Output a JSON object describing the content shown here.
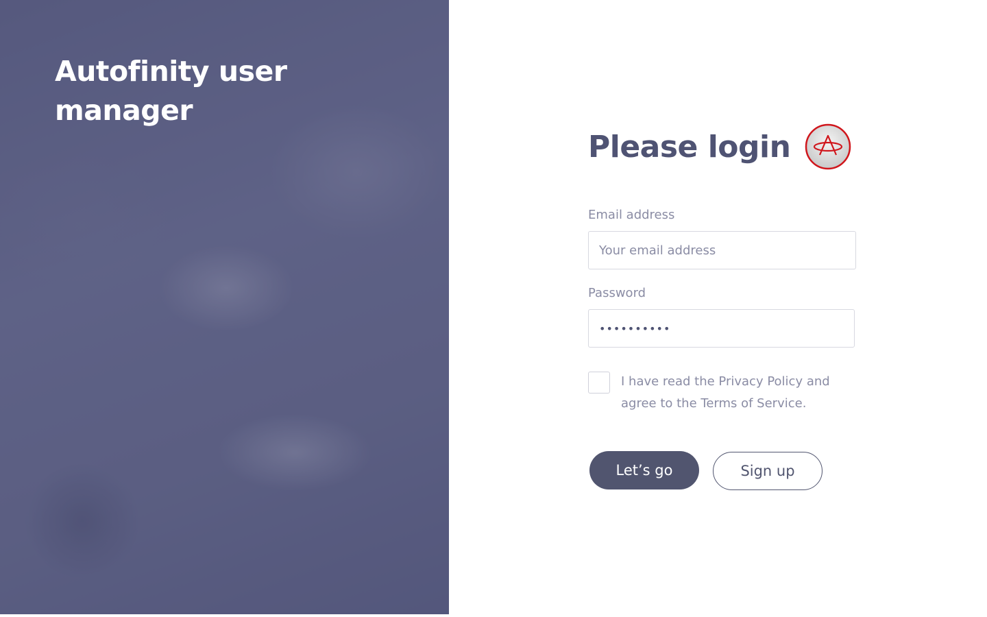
{
  "hero": {
    "title": "Autofinity user manager"
  },
  "form": {
    "heading": "Please login",
    "email": {
      "label": "Email address",
      "placeholder": "Your email address",
      "value": ""
    },
    "password": {
      "label": "Password",
      "value": "••••••••••"
    },
    "consent": {
      "checked": false,
      "text": "I have read the Privacy Policy and agree to the Terms of Service."
    },
    "submit_label": "Let’s go",
    "signup_label": "Sign up"
  },
  "brand": {
    "logo_icon": "autofinity-logo-icon",
    "accent_color": "#d0161c"
  },
  "colors": {
    "primary": "#51556f",
    "heading": "#4f5373",
    "muted_text": "#8a8ca4",
    "hero_overlay": "#5a5e83"
  }
}
